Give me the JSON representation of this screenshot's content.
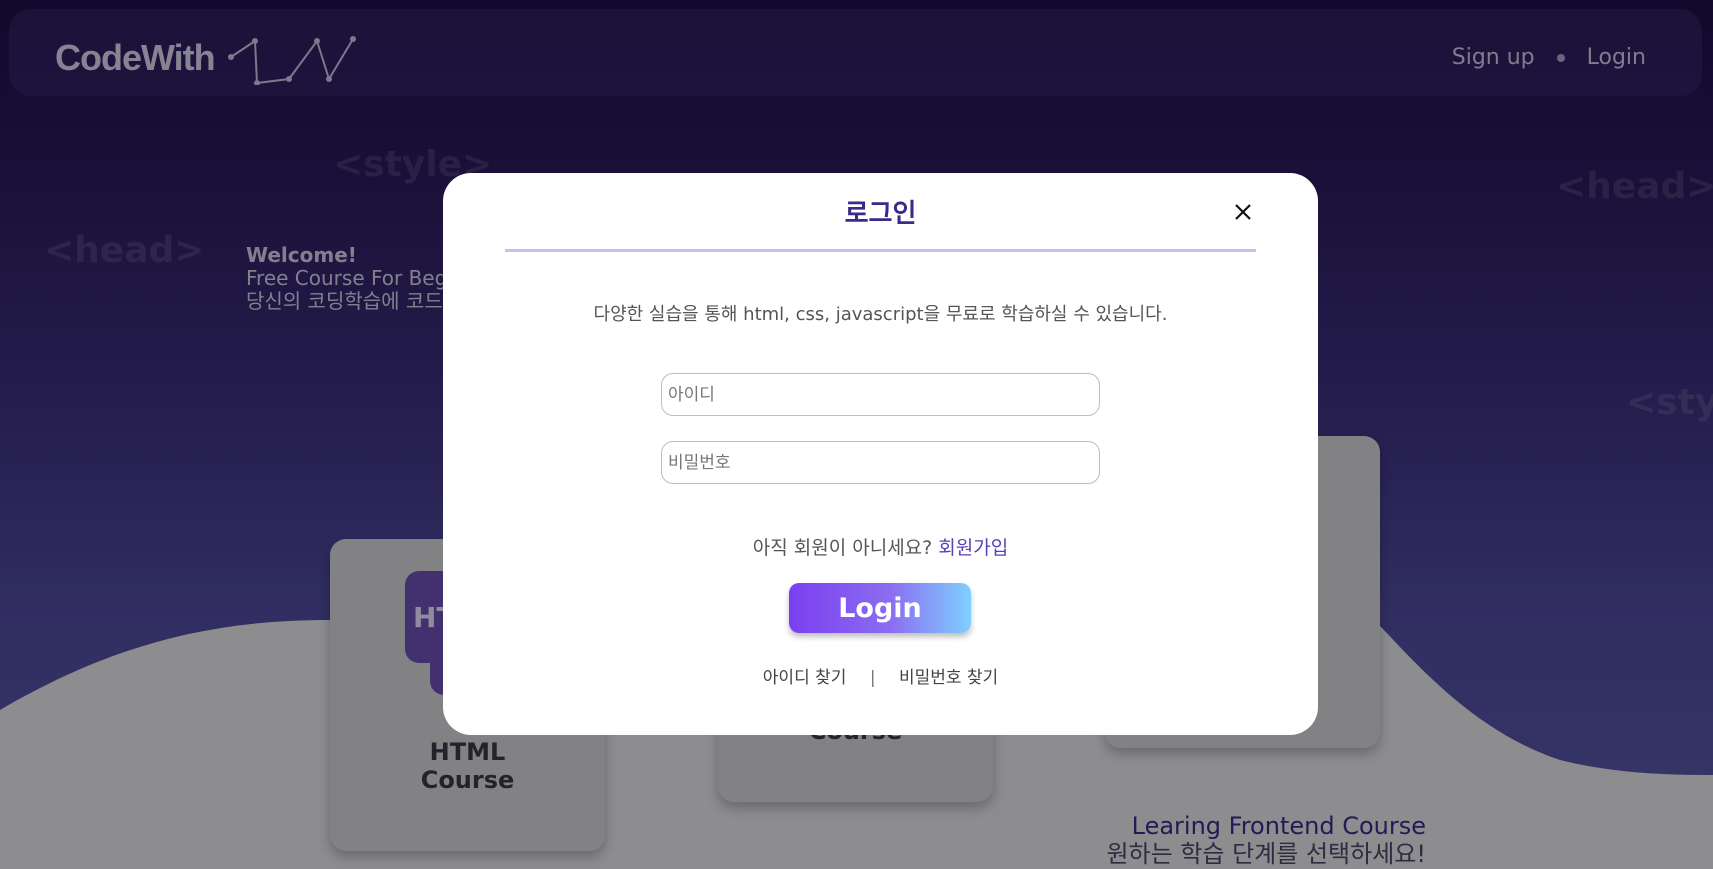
{
  "header": {
    "logo_text": "CodeWith",
    "nav": {
      "signup_label": "Sign up",
      "login_label": "Login"
    }
  },
  "background": {
    "deco_tags": [
      "<style>",
      "<head>",
      "<head>",
      "<style>"
    ],
    "welcome": {
      "line1": "Welcome!",
      "line2": "Free Course For Begin",
      "line3": "당신의 코딩학습에 코드"
    },
    "cards": [
      {
        "badge": "HT",
        "title_line1": "HTML",
        "title_line2": "Course"
      },
      {
        "title_line2": "Course"
      }
    ],
    "bottom": {
      "line1": "Learing Frontend Course",
      "line2": "원하는 학습 단계를 선택하세요!"
    }
  },
  "modal": {
    "title": "로그인",
    "description": "다양한 실습을 통해 html, css, javascript을 무료로 학습하실 수 있습니다.",
    "id_placeholder": "아이디",
    "password_placeholder": "비밀번호",
    "signup_prompt": "아직 회원이 아니세요?",
    "signup_link": "회원가입",
    "login_button": "Login",
    "find_id": "아이디 찾기",
    "separator": "|",
    "find_password": "비밀번호 찾기"
  },
  "colors": {
    "accent": "#3b2a8c",
    "link": "#5a3fb8",
    "button_gradient_start": "#7a3ff0",
    "button_gradient_end": "#7fd0ff"
  }
}
